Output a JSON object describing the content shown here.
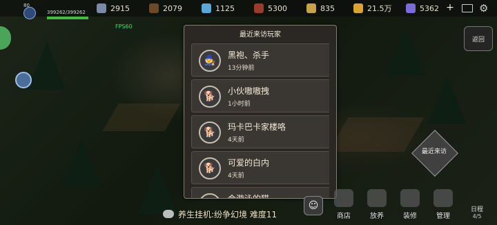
{
  "player": {
    "level": "80",
    "hp_text": "399262/399262",
    "hp_fraction": 1.0
  },
  "resources": [
    {
      "icon": "ore-icon",
      "value": "2915",
      "color": "#7b8aa6"
    },
    {
      "icon": "wood-icon",
      "value": "2079",
      "color": "#6b4a2a"
    },
    {
      "icon": "crystal-icon",
      "value": "1125",
      "color": "#5aa7d8"
    },
    {
      "icon": "chest-icon",
      "value": "5300",
      "color": "#9a3b2c"
    },
    {
      "icon": "feather-icon",
      "value": "835",
      "color": "#c9a24a"
    },
    {
      "icon": "gold-coin-icon",
      "value": "21.5万",
      "color": "#d9a52b"
    },
    {
      "icon": "diamond-icon",
      "value": "5362",
      "color": "#7b6ad8"
    }
  ],
  "fps": "FPS60",
  "back_label": "返回",
  "recent_visit_button": "最近来访",
  "modal": {
    "title": "最近来访玩家",
    "visitors": [
      {
        "name": "黑袍、杀手",
        "time": "13分钟前",
        "avatar": "hooded-player-avatar"
      },
      {
        "name": "小伙嗷嗷拽",
        "time": "1小时前",
        "avatar": "shiba-dog-avatar"
      },
      {
        "name": "玛卡巴卡家楼咯",
        "time": "4天前",
        "avatar": "shiba-dog-avatar"
      },
      {
        "name": "可爱的白内",
        "time": "4天前",
        "avatar": "shiba-dog-avatar"
      },
      {
        "name": "会游泳的猫",
        "time": "",
        "avatar": "cat-avatar"
      }
    ]
  },
  "chat_text": "养生挂机:纷争幻境 难度11",
  "nav": [
    {
      "label": "商店",
      "icon": "shop-icon"
    },
    {
      "label": "放养",
      "icon": "pasture-icon"
    },
    {
      "label": "装修",
      "icon": "decorate-icon"
    },
    {
      "label": "管理",
      "icon": "manage-icon"
    }
  ],
  "day": {
    "label": "日程",
    "count": "4/5"
  },
  "colors": {
    "hp": "#3fbf3a",
    "fps": "#2fe86a",
    "modal_bg": "#2b2824",
    "row_bg": "#3a3631"
  }
}
